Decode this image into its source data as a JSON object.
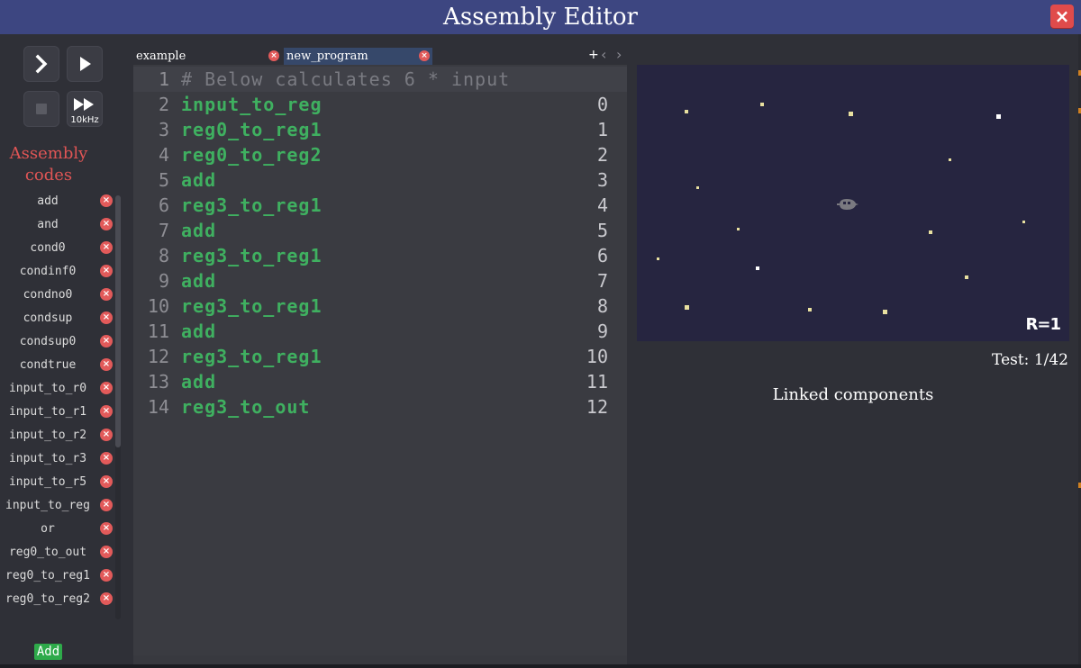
{
  "window": {
    "title": "Assembly Editor",
    "close_icon": "×"
  },
  "controls": {
    "step_icon": "chevron-right",
    "run_icon": "play",
    "stop_icon": "stop",
    "fast_icon": "fast-forward",
    "speed_label": "10kHz"
  },
  "sidebar": {
    "heading_line1": "Assembly",
    "heading_line2": "codes",
    "delete_icon": "×",
    "items": [
      {
        "label": "add"
      },
      {
        "label": "and"
      },
      {
        "label": "cond0"
      },
      {
        "label": "condinf0"
      },
      {
        "label": "condno0"
      },
      {
        "label": "condsup"
      },
      {
        "label": "condsup0"
      },
      {
        "label": "condtrue"
      },
      {
        "label": "input_to_r0"
      },
      {
        "label": "input_to_r1"
      },
      {
        "label": "input_to_r2"
      },
      {
        "label": "input_to_r3"
      },
      {
        "label": "input_to_r5"
      },
      {
        "label": "input_to_reg"
      },
      {
        "label": "or"
      },
      {
        "label": "reg0_to_out"
      },
      {
        "label": "reg0_to_reg1"
      },
      {
        "label": "reg0_to_reg2"
      }
    ],
    "add_label": "Add"
  },
  "tabs": {
    "items": [
      {
        "label": "example",
        "active": false
      },
      {
        "label": "new_program",
        "active": true
      }
    ],
    "close_icon": "×",
    "plus": "+",
    "prev": "‹",
    "next": "›"
  },
  "editor": {
    "lines": [
      {
        "num": "1",
        "code": "# Below calculates 6 * input",
        "addr": "",
        "comment": true
      },
      {
        "num": "2",
        "code": "input_to_reg",
        "addr": "0"
      },
      {
        "num": "3",
        "code": "reg0_to_reg1",
        "addr": "1"
      },
      {
        "num": "4",
        "code": "reg0_to_reg2",
        "addr": "2"
      },
      {
        "num": "5",
        "code": "add",
        "addr": "3"
      },
      {
        "num": "6",
        "code": "reg3_to_reg1",
        "addr": "4"
      },
      {
        "num": "7",
        "code": "add",
        "addr": "5"
      },
      {
        "num": "8",
        "code": "reg3_to_reg1",
        "addr": "6"
      },
      {
        "num": "9",
        "code": "add",
        "addr": "7"
      },
      {
        "num": "10",
        "code": "reg3_to_reg1",
        "addr": "8"
      },
      {
        "num": "11",
        "code": "add",
        "addr": "9"
      },
      {
        "num": "12",
        "code": "reg3_to_reg1",
        "addr": "10"
      },
      {
        "num": "13",
        "code": "add",
        "addr": "11"
      },
      {
        "num": "14",
        "code": "reg3_to_out",
        "addr": "12"
      }
    ]
  },
  "preview": {
    "register_label": "R=1",
    "test_count": "Test: 1/42",
    "linked_label": "Linked components",
    "colors": {
      "background": "#262540",
      "star": "#e8e0a0",
      "ship": "#7a7a80"
    }
  }
}
